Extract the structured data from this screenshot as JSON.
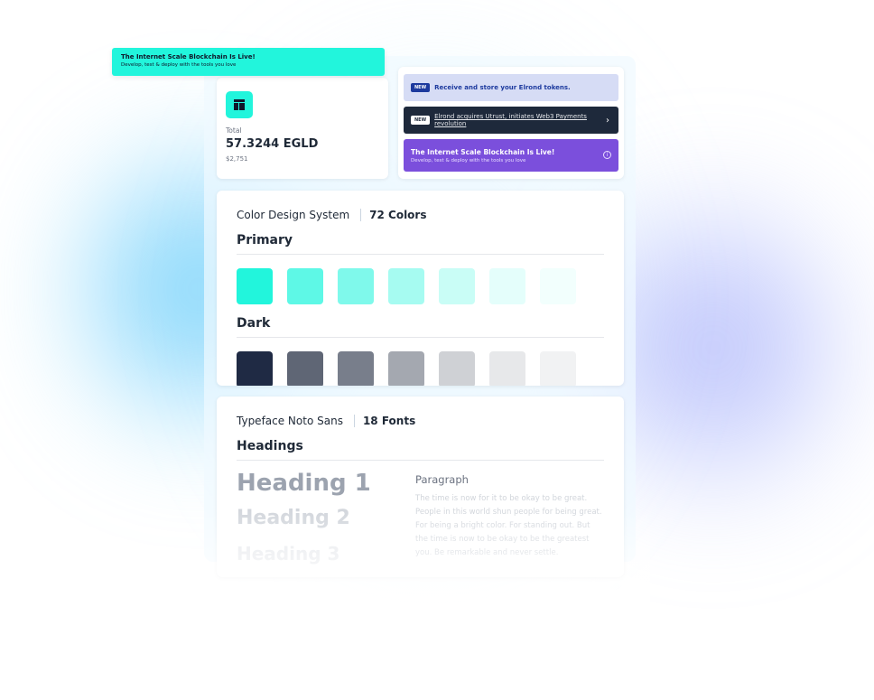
{
  "toast": {
    "title": "The Internet Scale Blockchain Is Live!",
    "subtitle": "Develop, test & deploy with the tools you love"
  },
  "balance": {
    "icon": "layout-icon",
    "label": "Total",
    "amount": "57.3244 EGLD",
    "usd": "$2,751"
  },
  "alerts": [
    {
      "badge": "NEW",
      "text": "Receive and store your Elrond tokens."
    },
    {
      "badge": "NEW",
      "text": "Elrond acquires Utrust, initiates Web3 Payments revolution",
      "icon": "chevron-right-icon"
    },
    {
      "title": "The Internet Scale Blockchain Is Live!",
      "subtitle": "Develop, test & deploy with the tools you love",
      "icon": "info-icon"
    }
  ],
  "color_system": {
    "title": "Color Design System",
    "count": "72 Colors",
    "groups": [
      {
        "name": "Primary",
        "swatches": [
          "#22f5dc",
          "#5ef8e6",
          "#7ff9eb",
          "#a6fbf1",
          "#c9fdf6",
          "#e4fefb",
          "#f2fffd"
        ]
      },
      {
        "name": "Dark",
        "swatches": [
          "#1f2a44",
          "#5f6675",
          "#787e8b",
          "#a4a8b0",
          "#cfd1d5",
          "#e7e8ea",
          "#f1f2f3"
        ]
      }
    ]
  },
  "typeface": {
    "title": "Typeface Noto Sans",
    "count": "18 Fonts",
    "headings_title": "Headings",
    "headings": [
      "Heading 1",
      "Heading 2",
      "Heading 3"
    ],
    "paragraph_title": "Paragraph",
    "paragraph": "The time is now for it to be okay to be great. People in this world shun people for being great. For being a bright color. For standing out. But the time is now to be okay to be the greatest you. Be remarkable and never settle."
  }
}
